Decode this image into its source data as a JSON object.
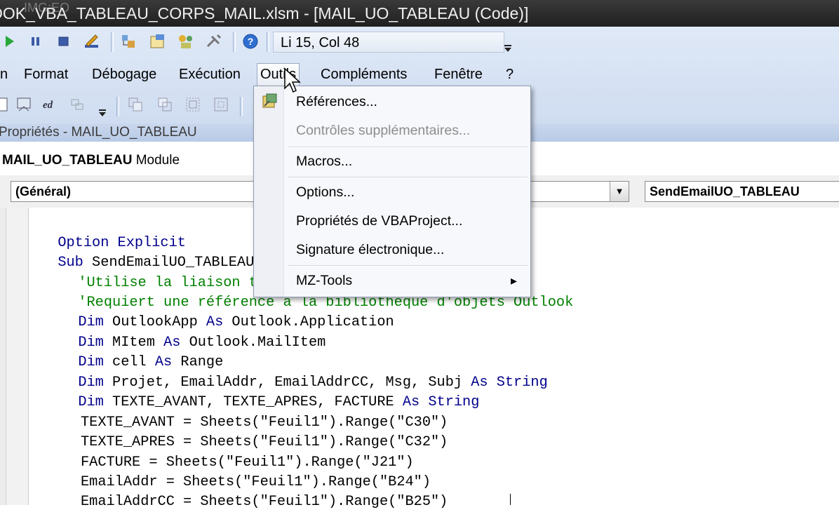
{
  "window": {
    "title": "OOK_VBA_TABLEAU_CORPS_MAIL.xlsm - [MAIL_UO_TABLEAU (Code)]",
    "watermark": "IMG:EO"
  },
  "toolbar": {
    "position": "Li 15, Col 48"
  },
  "menubar": {
    "items": [
      "n",
      "Format",
      "Débogage",
      "Exécution",
      "Outils",
      "Compléments",
      "Fenêtre",
      "?"
    ]
  },
  "properties": {
    "title": "Propriétés - MAIL_UO_TABLEAU"
  },
  "module": {
    "name": "MAIL_UO_TABLEAU",
    "kind": "Module"
  },
  "combos": {
    "object": "(Général)",
    "procedure": "SendEmailUO_TABLEAU"
  },
  "outils_menu": {
    "items": [
      {
        "label": "Références...",
        "enabled": true
      },
      {
        "label": "Contrôles supplémentaires...",
        "enabled": false
      },
      {
        "label": "Macros...",
        "enabled": true
      },
      {
        "label": "Options...",
        "enabled": true
      },
      {
        "label": "Propriétés de VBAProject...",
        "enabled": true
      },
      {
        "label": "Signature électronique...",
        "enabled": true
      },
      {
        "label": "MZ-Tools",
        "enabled": true,
        "submenu": "▸"
      }
    ]
  },
  "code": {
    "l1": {
      "a": "Option Explicit"
    },
    "l2": {
      "a": "Sub",
      "b": " SendEmailUO_TABLEAU()"
    },
    "l3": {
      "a": "'Utilise la liaison tardive"
    },
    "l4": {
      "a": "'Requiert une référence à la bibliothèque d'objets Outlook"
    },
    "l5": {
      "a": "Dim",
      "b": " OutlookApp ",
      "c": "As",
      "d": " Outlook.Application"
    },
    "l6": {
      "a": "Dim",
      "b": " MItem ",
      "c": "As",
      "d": " Outlook.MailItem"
    },
    "l7": {
      "a": "Dim",
      "b": " cell ",
      "c": "As",
      "d": " Range"
    },
    "l8": {
      "a": "Dim",
      "b": " Projet, EmailAddr, EmailAddrCC, Msg, Subj ",
      "c": "As",
      "d": " ",
      "e": "String"
    },
    "l9": {
      "a": "Dim",
      "b": " TEXTE_AVANT, TEXTE_APRES, FACTURE ",
      "c": "As",
      "d": " ",
      "e": "String"
    },
    "l10": "TEXTE_AVANT = Sheets(\"Feuil1\").Range(\"C30\")",
    "l11": "TEXTE_APRES = Sheets(\"Feuil1\").Range(\"C32\")",
    "l12": "FACTURE = Sheets(\"Feuil1\").Range(\"J21\")",
    "l13": "EmailAddr = Sheets(\"Feuil1\").Range(\"B24\")",
    "l14": "EmailAddrCC = Sheets(\"Feuil1\").Range(\"B25\")"
  }
}
